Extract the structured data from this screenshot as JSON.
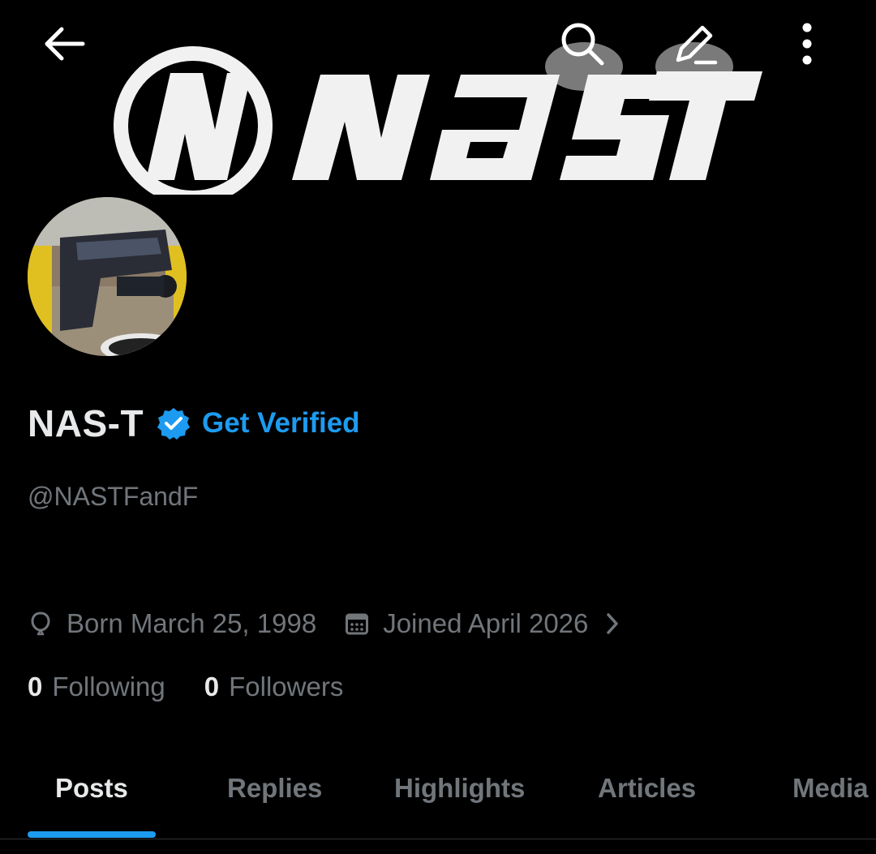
{
  "banner": {
    "logo_text": "NAST",
    "logo_letter": "N",
    "colors": {
      "text": "#ffffff",
      "background": "#000000"
    }
  },
  "topbar": {
    "back_icon": "arrow-left-icon",
    "search_icon": "search-icon",
    "edit_icon": "edit-icon",
    "more_icon": "more-vertical-icon"
  },
  "profile": {
    "display_name": "NAS-T",
    "verified_icon": "verified-badge-icon",
    "get_verified_label": "Get Verified",
    "handle": "@NASTFandF",
    "born": "Born March 25, 1998",
    "joined": "Joined April 2026",
    "following_count": "0",
    "following_label": "Following",
    "followers_count": "0",
    "followers_label": "Followers"
  },
  "tabs": [
    {
      "label": "Posts",
      "active": true
    },
    {
      "label": "Replies",
      "active": false
    },
    {
      "label": "Highlights",
      "active": false
    },
    {
      "label": "Articles",
      "active": false
    },
    {
      "label": "Media",
      "active": false
    }
  ],
  "colors": {
    "accent": "#1d9bf0",
    "primary_text": "#e7e9ea",
    "secondary_text": "#71767b",
    "background": "#000000"
  }
}
